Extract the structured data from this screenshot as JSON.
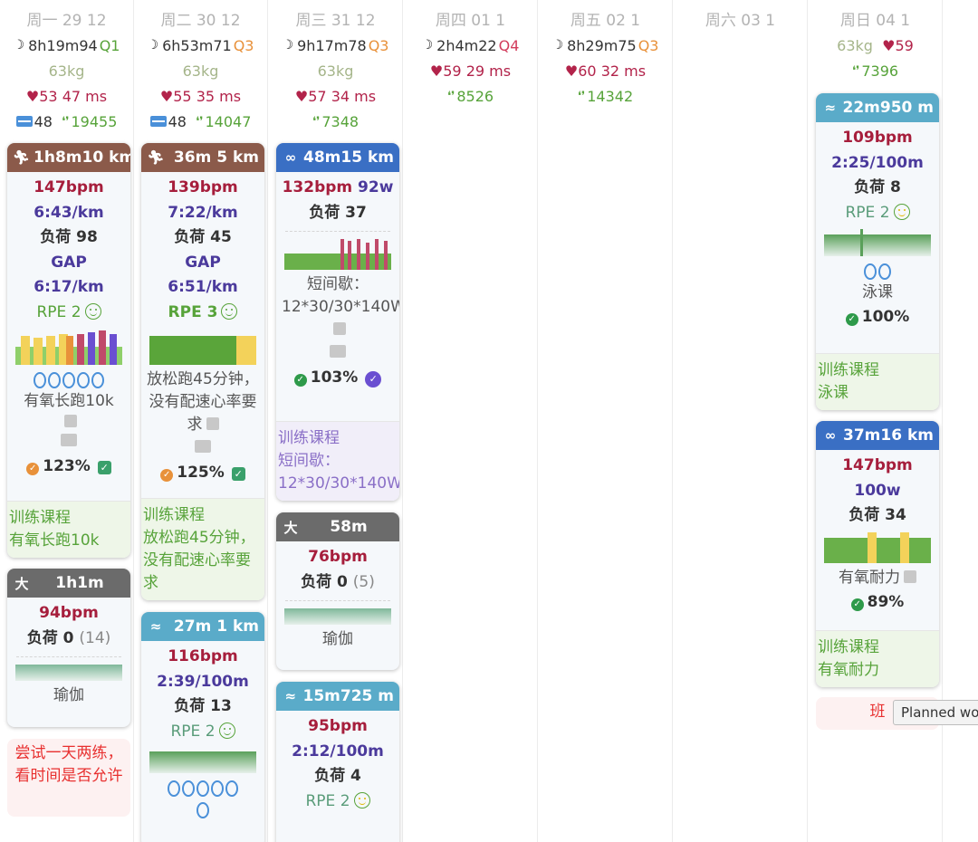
{
  "days": [
    {
      "header": "周一 29 12",
      "sleep": "8h19m",
      "sleep_score": "94",
      "quality": "Q1",
      "weight": "63kg",
      "rhr": "53",
      "hrv": "47 ms",
      "stress": "48",
      "steps": "19455"
    },
    {
      "header": "周二 30 12",
      "sleep": "6h53m",
      "sleep_score": "71",
      "quality": "Q3",
      "weight": "63kg",
      "rhr": "55",
      "hrv": "35 ms",
      "stress": "48",
      "steps": "14047"
    },
    {
      "header": "周三 31 12",
      "sleep": "9h17m",
      "sleep_score": "78",
      "quality": "Q3",
      "weight": "63kg",
      "rhr": "57",
      "hrv": "34 ms",
      "steps": "7348"
    },
    {
      "header": "周四 01 1",
      "sleep": "2h4m",
      "sleep_score": "22",
      "quality": "Q4",
      "rhr": "59",
      "hrv": "29 ms",
      "steps": "8526"
    },
    {
      "header": "周五 02 1",
      "sleep": "8h29m",
      "sleep_score": "75",
      "quality": "Q3",
      "rhr": "60",
      "hrv": "32 ms",
      "steps": "14342"
    },
    {
      "header": "周六 03 1"
    },
    {
      "header": "周日 04 1",
      "weight": "63kg",
      "rhr": "59",
      "steps": "7396"
    }
  ],
  "icons": {
    "moon": "moon-icon",
    "heart": "heart-icon",
    "steps": "footsteps-icon",
    "stress": "stress-icon",
    "run": "run-icon",
    "bike": "bike-icon",
    "swim": "swim-icon",
    "yoga": "yoga-icon"
  },
  "colors": {
    "run": "#8b5a4a",
    "bike": "#3a6fc4",
    "swim": "#5aabc9",
    "yoga": "#6b6b6b",
    "bpm": "#a61e3c",
    "pace": "#4b3a9c",
    "green": "#57a33a"
  },
  "w1": {
    "dur": "1h8m",
    "dist": "10 km",
    "bpm": "147bpm",
    "pace": "6:43/km",
    "load": "负荷 98",
    "gap_label": "GAP",
    "gap": "6:17/km",
    "rpe": "RPE 2",
    "note": "有氧长跑10k",
    "compliance": "123%",
    "plan_title": "训练课程",
    "plan_name": "有氧长跑10k"
  },
  "w2": {
    "dur": "1h1m",
    "bpm": "94bpm",
    "load": "负荷 0",
    "load_extra": "(14)",
    "name": "瑜伽"
  },
  "mon_note": "尝试一天两练，看时间是否允许",
  "t1": {
    "dur": "36m",
    "dist": "5 km",
    "bpm": "139bpm",
    "pace": "7:22/km",
    "load": "负荷 45",
    "gap_label": "GAP",
    "gap": "6:51/km",
    "rpe": "RPE 3",
    "note": "放松跑45分钟，没有配速心率要求",
    "compliance": "125%",
    "plan_title": "训练课程",
    "plan_name": "放松跑45分钟，没有配速心率要求"
  },
  "t2": {
    "dur": "27m",
    "dist": "1 km",
    "bpm": "116bpm",
    "pace": "2:39/100m",
    "load": "负荷 13",
    "rpe": "RPE 2"
  },
  "we1": {
    "dur": "48m",
    "dist": "15 km",
    "bpm": "132bpm",
    "power": "92w",
    "load": "负荷 37",
    "note": "短间歇：12*30/30*140W",
    "compliance": "103%",
    "plan_title": "训练课程",
    "plan_name": "短间歇：12*30/30*140W"
  },
  "we2": {
    "dur": "58m",
    "bpm": "76bpm",
    "load": "负荷 0",
    "load_extra": "(5)",
    "name": "瑜伽"
  },
  "we3": {
    "dur": "15m",
    "dist": "725 m",
    "bpm": "95bpm",
    "pace": "2:12/100m",
    "load": "负荷 4",
    "rpe": "RPE 2"
  },
  "su1": {
    "dur": "22m",
    "dist": "950 m",
    "bpm": "109bpm",
    "pace": "2:25/100m",
    "load": "负荷 8",
    "rpe": "RPE 2",
    "note": "泳课",
    "compliance": "100%",
    "plan_title": "训练课程",
    "plan_name": "泳课"
  },
  "su2": {
    "dur": "37m",
    "dist": "16 km",
    "bpm": "147bpm",
    "power": "100w",
    "load": "负荷 34",
    "note": "有氧耐力",
    "compliance": "89%",
    "plan_title": "训练课程",
    "plan_name": "有氧耐力"
  },
  "sun_note": "班",
  "tooltip": "Planned wor"
}
